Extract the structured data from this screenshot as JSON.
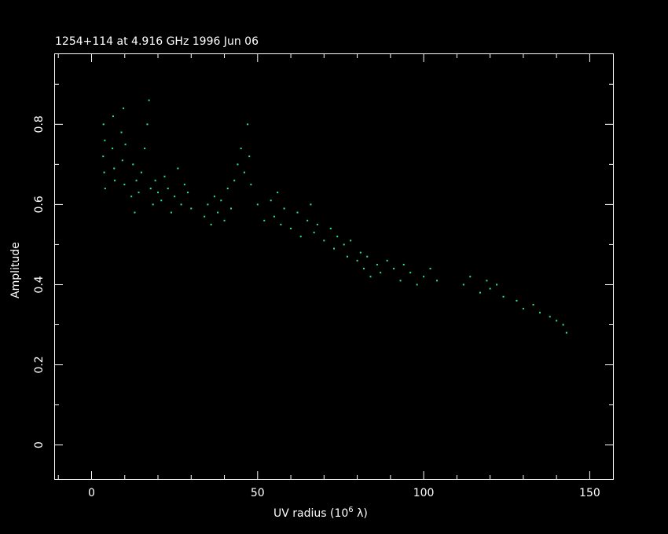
{
  "chart_data": {
    "type": "scatter",
    "title": "1254+114 at 4.916 GHz 1996 Jun 06",
    "xlabel": "UV radius  (10",
    "xlabel_exp": "6",
    "xlabel_unit": " λ)",
    "ylabel": "Amplitude",
    "xlim": [
      -11,
      157
    ],
    "ylim": [
      -0.085,
      0.975
    ],
    "x_major_ticks": [
      0,
      50,
      100,
      150
    ],
    "x_tick_labels": [
      "0",
      "50",
      "100",
      "150"
    ],
    "x_minor_step": 10,
    "y_major_ticks": [
      0,
      0.2,
      0.4,
      0.6,
      0.8
    ],
    "y_tick_labels": [
      "0",
      "0.2",
      "0.4",
      "0.6",
      "0.8"
    ],
    "y_minor_step": 0.1,
    "point_color": "#2ee68a",
    "frame_color": "#ffffff",
    "background": "#000000",
    "series": [
      {
        "x": [
          3.5,
          3.6,
          3.8,
          4.0,
          4.1,
          6.3,
          6.5,
          6.8,
          7.0,
          9.0,
          9.3,
          9.6,
          9.9,
          10.2,
          12.0,
          12.5,
          13.0,
          13.5,
          14.2,
          15.0,
          16.0,
          16.8,
          17.3,
          17.8,
          18.5,
          19.2,
          20.0,
          21.0,
          22.0,
          23.0,
          24.0,
          25.0,
          26.0,
          27.0,
          28.0,
          29.0,
          30.0,
          34.0,
          35.0,
          36.0,
          37.0,
          38.0,
          39.0,
          40.0,
          41.0,
          42.0,
          43.0,
          44.0,
          45.0,
          46.0,
          47.0,
          47.5,
          48.0,
          50.0,
          52.0,
          54.0,
          55.0,
          56.0,
          57.0,
          58.0,
          60.0,
          62.0,
          63.0,
          65.0,
          66.0,
          67.0,
          68.0,
          70.0,
          72.0,
          73.0,
          74.0,
          76.0,
          77.0,
          78.0,
          80.0,
          81.0,
          82.0,
          83.0,
          84.0,
          86.0,
          87.0,
          89.0,
          91.0,
          93.0,
          94.0,
          96.0,
          98.0,
          100.0,
          102.0,
          104.0,
          112.0,
          114.0,
          117.0,
          119.0,
          120.0,
          122.0,
          124.0,
          128.0,
          130.0,
          133.0,
          135.0,
          138.0,
          140.0,
          142.0,
          143.0
        ],
        "y": [
          0.72,
          0.8,
          0.68,
          0.76,
          0.64,
          0.74,
          0.82,
          0.69,
          0.66,
          0.78,
          0.71,
          0.84,
          0.65,
          0.75,
          0.62,
          0.7,
          0.58,
          0.66,
          0.63,
          0.68,
          0.74,
          0.8,
          0.86,
          0.64,
          0.6,
          0.66,
          0.63,
          0.61,
          0.67,
          0.64,
          0.58,
          0.62,
          0.69,
          0.6,
          0.65,
          0.63,
          0.59,
          0.57,
          0.6,
          0.55,
          0.62,
          0.58,
          0.61,
          0.56,
          0.64,
          0.59,
          0.66,
          0.7,
          0.74,
          0.68,
          0.8,
          0.72,
          0.65,
          0.6,
          0.56,
          0.61,
          0.57,
          0.63,
          0.55,
          0.59,
          0.54,
          0.58,
          0.52,
          0.56,
          0.6,
          0.53,
          0.55,
          0.51,
          0.54,
          0.49,
          0.52,
          0.5,
          0.47,
          0.51,
          0.46,
          0.48,
          0.44,
          0.47,
          0.42,
          0.45,
          0.43,
          0.46,
          0.44,
          0.41,
          0.45,
          0.43,
          0.4,
          0.42,
          0.44,
          0.41,
          0.4,
          0.42,
          0.38,
          0.41,
          0.39,
          0.4,
          0.37,
          0.36,
          0.34,
          0.35,
          0.33,
          0.32,
          0.31,
          0.3,
          0.28
        ]
      }
    ]
  }
}
